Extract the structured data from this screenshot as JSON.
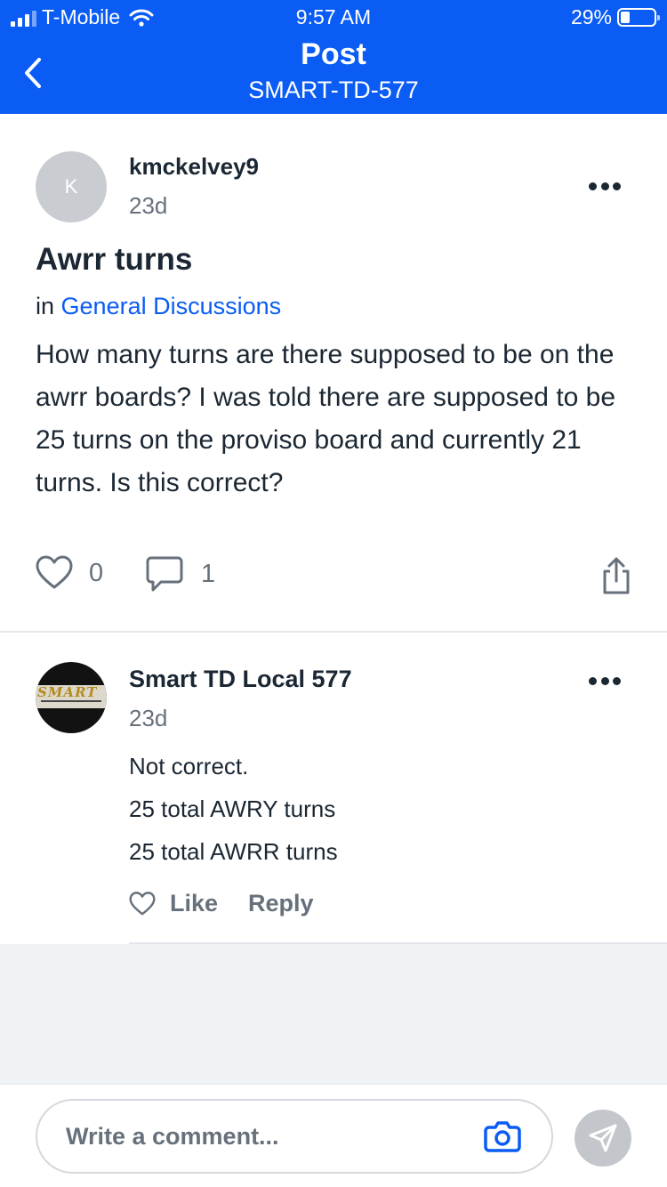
{
  "status_bar": {
    "carrier": "T-Mobile",
    "time": "9:57 AM",
    "battery_percent": "29%",
    "battery_level": 0.29
  },
  "header": {
    "back_icon": "chevron-left-icon",
    "title": "Post",
    "subtitle": "SMART-TD-577",
    "background_color": "#0a5cf5"
  },
  "post": {
    "avatar_letter": "K",
    "author": "kmckelvey9",
    "age": "23d",
    "title": "Awrr turns",
    "category_prefix": "in",
    "category": "General Discussions",
    "body": "How many turns are there supposed to be on the awrr boards? I was told there are supposed to be 25 turns on the proviso board and currently 21 turns. Is this correct?",
    "like_count": "0",
    "comment_count": "1"
  },
  "reply": {
    "author": "Smart TD Local 577",
    "avatar_logo_text": "SMART",
    "age": "23d",
    "lines": [
      "Not correct.",
      "25 total AWRY turns",
      "25 total AWRR turns"
    ],
    "like_label": "Like",
    "reply_label": "Reply"
  },
  "composer": {
    "placeholder": "Write a comment..."
  },
  "colors": {
    "accent": "#0a5cf5",
    "muted_text": "#67717c",
    "primary_text": "#1b2733"
  }
}
